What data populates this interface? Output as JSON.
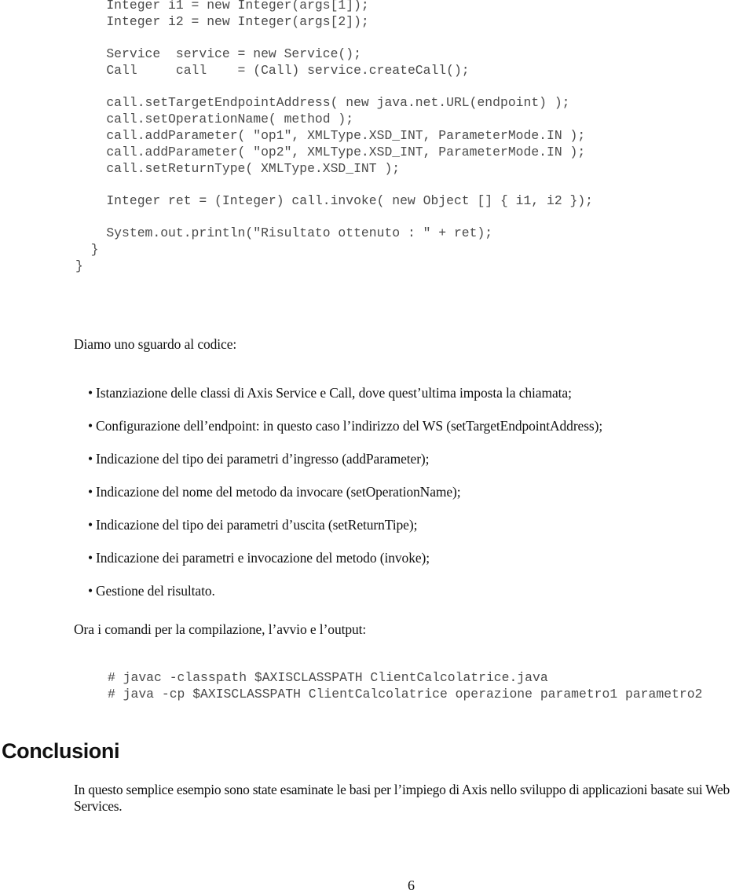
{
  "code_block_main": {
    "lines": [
      "    Integer i1 = new Integer(args[1]);",
      "    Integer i2 = new Integer(args[2]);",
      "",
      "    Service  service = new Service();",
      "    Call     call    = (Call) service.createCall();",
      "",
      "    call.setTargetEndpointAddress( new java.net.URL(endpoint) );",
      "    call.setOperationName( method );",
      "    call.addParameter( \"op1\", XMLType.XSD_INT, ParameterMode.IN );",
      "    call.addParameter( \"op2\", XMLType.XSD_INT, ParameterMode.IN );",
      "    call.setReturnType( XMLType.XSD_INT );",
      "",
      "    Integer ret = (Integer) call.invoke( new Object [] { i1, i2 });",
      "",
      "    System.out.println(\"Risultato ottenuto : \" + ret);",
      "  }",
      "}"
    ]
  },
  "intro_text": "Diamo uno sguardo al codice:",
  "bullets": [
    "Istanziazione delle classi di Axis Service e Call, dove quest’ultima imposta la chiamata;",
    "Configurazione dell’endpoint: in questo caso l’indirizzo del WS (setTargetEndpointAddress);",
    "Indicazione del tipo dei parametri d’ingresso (addParameter);",
    "Indicazione del nome del metodo da invocare (setOperationName);",
    "Indicazione del tipo dei parametri d’uscita (setReturnTipe);",
    "Indicazione dei parametri e invocazione del metodo (invoke);",
    "Gestione del risultato."
  ],
  "bullet_symbol": "•",
  "commands_intro": "Ora i comandi per la compilazione, l’avvio e l’output:",
  "commands": [
    "# javac -classpath $AXISCLASSPATH ClientCalcolatrice.java",
    "# java -cp $AXISCLASSPATH ClientCalcolatrice operazione parametro1 parametro2"
  ],
  "section": {
    "heading": "Conclusioni",
    "paragraph": "In questo semplice esempio sono state esaminate le basi per l’impiego di Axis nello sviluppo di applicazioni basate sui Web Services."
  },
  "page_number": "6"
}
